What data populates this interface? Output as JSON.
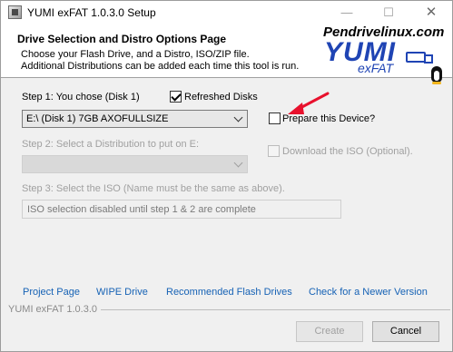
{
  "window": {
    "title": "YUMI exFAT 1.0.3.0 Setup"
  },
  "titlebar": {
    "minimize": "—",
    "maximize": "☐",
    "close": "✕"
  },
  "header": {
    "title": "Drive Selection and Distro Options Page",
    "line1": "Choose your Flash Drive, and a Distro, ISO/ZIP file.",
    "line2": "Additional Distributions can be added each time this tool is run.",
    "site": "Pendrivelinux.com",
    "logo": "YUMI",
    "logo_sub": "exFAT"
  },
  "step1": {
    "label": "Step 1: You chose (Disk 1)",
    "refreshed_label": "Refreshed Disks",
    "refreshed_checked": true,
    "drive_value": "E:\\ (Disk 1) 7GB AXOFULLSIZE",
    "prepare_label": "Prepare this Device?",
    "prepare_checked": false
  },
  "step2": {
    "label": "Step 2: Select a Distribution to put on E:",
    "distro_value": "",
    "download_label": "Download the ISO (Optional).",
    "download_checked": false
  },
  "step3": {
    "label": "Step 3: Select the ISO (Name must be the same as above).",
    "iso_value": "ISO selection disabled until step 1 & 2 are complete"
  },
  "links": {
    "project": "Project Page",
    "wipe": "WIPE Drive",
    "recommended": "Recommended Flash Drives",
    "newer": "Check for a Newer Version"
  },
  "footer": {
    "version": "YUMI exFAT 1.0.3.0",
    "create": "Create",
    "cancel": "Cancel"
  },
  "colors": {
    "link": "#1662b5",
    "logo": "#1f44b4",
    "arrow": "#e8112d"
  }
}
